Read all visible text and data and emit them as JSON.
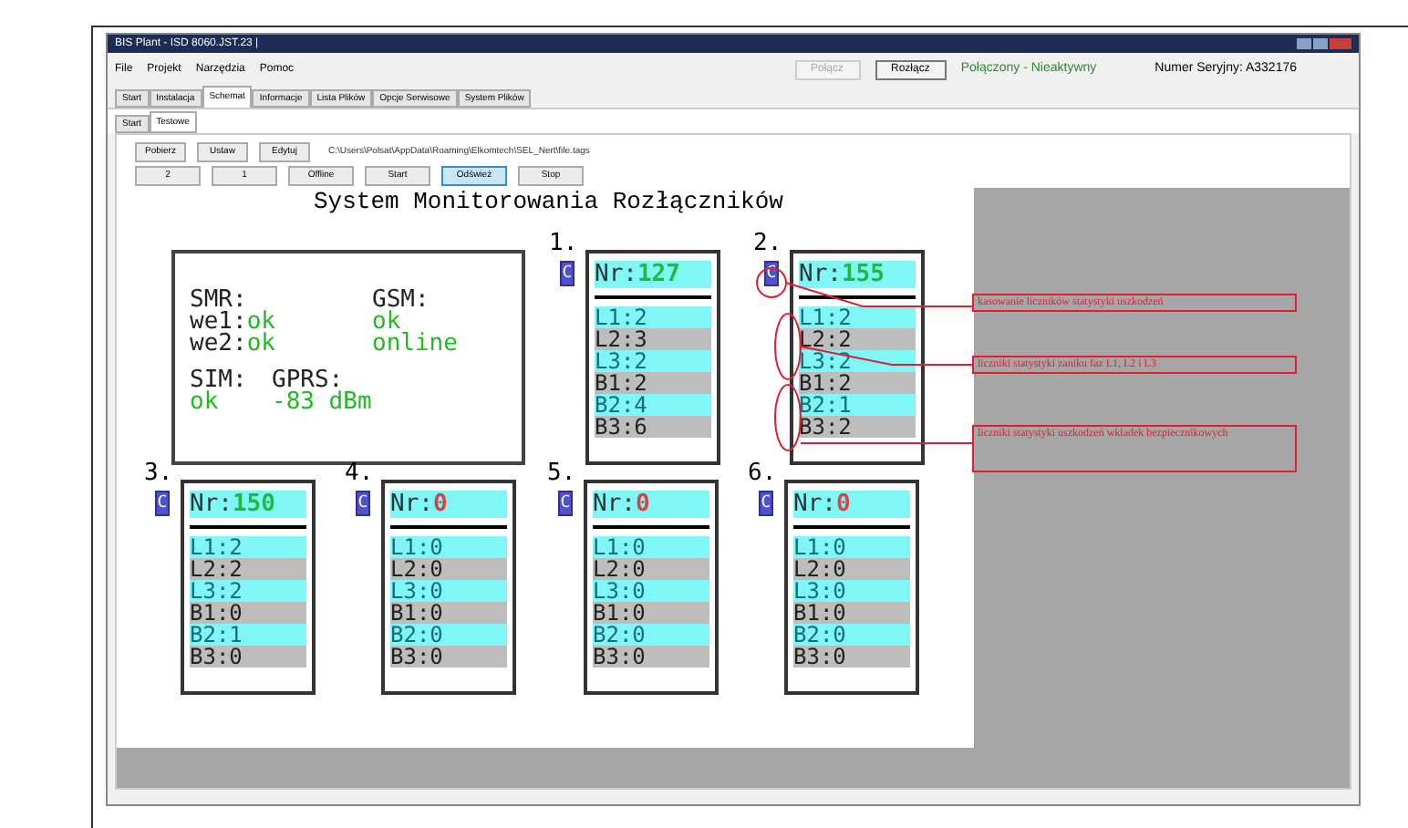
{
  "window": {
    "title": "BIS Plant - ISD 8060.JST.23 |"
  },
  "menu": [
    "File",
    "Projekt",
    "Narzędzia",
    "Pomoc"
  ],
  "header": {
    "buttons": [
      {
        "label": "Połącz",
        "disabled": true
      },
      {
        "label": "Rozłącz",
        "disabled": false
      }
    ],
    "status": "Połączony - Nieaktywny",
    "serial": "Numer Seryjny: A332176"
  },
  "tabs": [
    {
      "label": "Start",
      "selected": false
    },
    {
      "label": "Instalacja",
      "selected": false
    },
    {
      "label": "Schemat",
      "selected": true
    },
    {
      "label": "Informacje",
      "selected": false
    },
    {
      "label": "Lista Plików",
      "selected": false
    },
    {
      "label": "Opcje Serwisowe",
      "selected": false
    },
    {
      "label": "System Plików",
      "selected": false
    }
  ],
  "subtabs": [
    {
      "label": "Start",
      "selected": false
    },
    {
      "label": "Testowe",
      "selected": true
    }
  ],
  "toolbar_row1": [
    "Pobierz",
    "Ustaw",
    "Edytuj"
  ],
  "path": "C:\\Users\\Polsat\\AppData\\Roaming\\Elkomtech\\SEL_Nert\\file.tags",
  "toolbar_row2": [
    {
      "label": "2",
      "selected": false
    },
    {
      "label": "1",
      "selected": false
    },
    {
      "label": "Offline",
      "selected": false
    },
    {
      "label": "Start",
      "selected": false
    },
    {
      "label": "Odśwież",
      "selected": true
    },
    {
      "label": "Stop",
      "selected": false
    }
  ],
  "canvas": {
    "title": "System Monitorowania Rozłączników",
    "info": [
      {
        "lines": [
          {
            "label": "SMR:"
          },
          {
            "label": "we1:",
            "value": "ok"
          },
          {
            "label": "we2:",
            "value": "ok"
          }
        ]
      },
      {
        "lines": [
          {
            "label": "GSM:"
          },
          {
            "value": "ok"
          },
          {
            "value": "online"
          }
        ]
      },
      {
        "lines": [
          {
            "label": "SIM:"
          },
          {
            "value": "ok"
          }
        ]
      },
      {
        "lines": [
          {
            "label": "GPRS:"
          },
          {
            "value": "-83 dBm"
          }
        ]
      }
    ],
    "units": [
      {
        "index": "1.",
        "reset": "C",
        "nr_label": "Nr:",
        "nr": "127",
        "active": true,
        "counters": [
          "L1:2",
          "L2:3",
          "L3:2",
          "B1:2",
          "B2:4",
          "B3:6"
        ]
      },
      {
        "index": "2.",
        "reset": "C",
        "nr_label": "Nr:",
        "nr": "155",
        "active": true,
        "counters": [
          "L1:2",
          "L2:2",
          "L3:2",
          "B1:2",
          "B2:1",
          "B3:2"
        ]
      },
      {
        "index": "3.",
        "reset": "C",
        "nr_label": "Nr:",
        "nr": "150",
        "active": true,
        "counters": [
          "L1:2",
          "L2:2",
          "L3:2",
          "B1:0",
          "B2:1",
          "B3:0"
        ]
      },
      {
        "index": "4.",
        "reset": "C",
        "nr_label": "Nr:",
        "nr": "0",
        "active": false,
        "counters": [
          "L1:0",
          "L2:0",
          "L3:0",
          "B1:0",
          "B2:0",
          "B3:0"
        ]
      },
      {
        "index": "5.",
        "reset": "C",
        "nr_label": "Nr:",
        "nr": "0",
        "active": false,
        "counters": [
          "L1:0",
          "L2:0",
          "L3:0",
          "B1:0",
          "B2:0",
          "B3:0"
        ]
      },
      {
        "index": "6.",
        "reset": "C",
        "nr_label": "Nr:",
        "nr": "0",
        "active": false,
        "counters": [
          "L1:0",
          "L2:0",
          "L3:0",
          "B1:0",
          "B2:0",
          "B3:0"
        ]
      }
    ],
    "annotations": [
      "kasowanie liczników statystyki uszkodzeń",
      "liczniki statystyki zaniku faz L1, L2 i L3",
      "liczniki statystyki uszkodzeń wkładek bezpiecznikowych"
    ]
  }
}
